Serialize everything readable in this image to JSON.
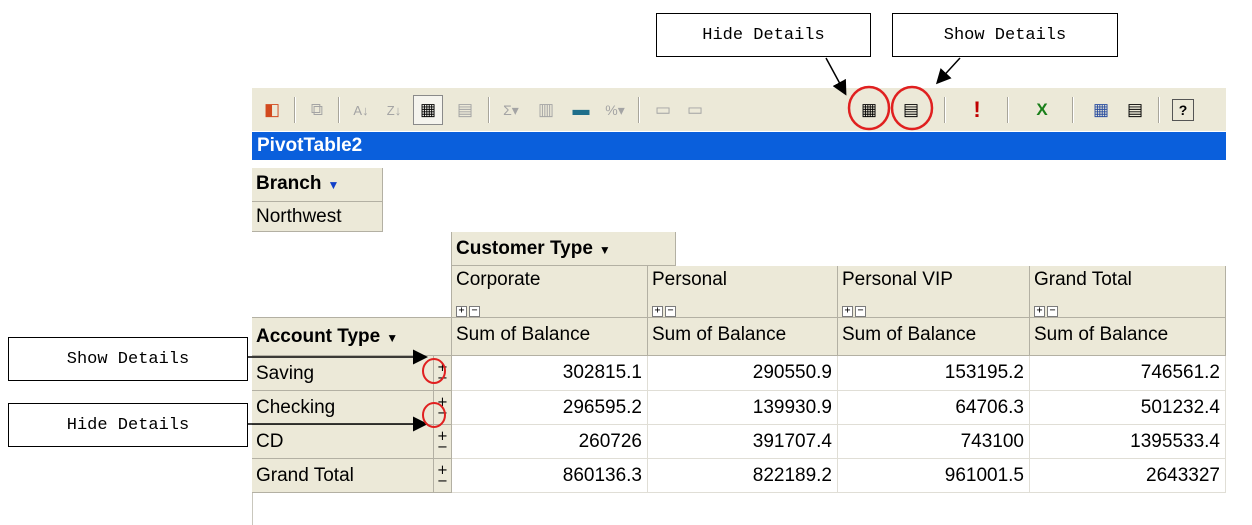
{
  "callouts": {
    "hide_details_top": "Hide Details",
    "show_details_top": "Show Details",
    "show_details_left": "Show Details",
    "hide_details_left": "Hide Details"
  },
  "toolbar": {
    "icons": [
      "office-logo-icon",
      "copy-icon",
      "sort-ascending-icon",
      "sort-descending-icon",
      "autofilter-icon",
      "show-top-bottom-icon",
      "autocalc-icon",
      "subtotal-icon",
      "calculated-totals-icon",
      "show-as-icon",
      "collapse-icon",
      "expand-icon",
      "hide-details-icon",
      "show-details-icon",
      "refresh-icon",
      "export-excel-icon",
      "field-list-icon",
      "property-toolbox-icon",
      "help-icon"
    ],
    "glyphs": {
      "office": "◧",
      "copy": "⧉",
      "sort_asc": "A↓",
      "sort_desc": "Z↓",
      "autofilter": "▦",
      "topbottom": "▤",
      "autocalc": "Σ▾",
      "subtotal": "▥",
      "calc": "▬",
      "showas": "%▾",
      "collapse": "▭",
      "expand": "▭",
      "hide": "▦",
      "show": "▤",
      "refresh": "!",
      "excel": "X",
      "fieldlist": "▦",
      "toolbox": "▤",
      "help": "?"
    }
  },
  "pivot": {
    "title": "PivotTable2",
    "filter_field": "Branch",
    "filter_value": "Northwest",
    "column_field": "Customer Type",
    "row_field": "Account Type",
    "columns": [
      "Corporate",
      "Personal",
      "Personal VIP",
      "Grand Total"
    ],
    "measure_label": "Sum of Balance",
    "plus": "+",
    "minus": "−",
    "rows": [
      {
        "label": "Saving",
        "values": [
          "302815.1",
          "290550.9",
          "153195.2",
          "746561.2"
        ]
      },
      {
        "label": "Checking",
        "values": [
          "296595.2",
          "139930.9",
          "64706.3",
          "501232.4"
        ]
      },
      {
        "label": "CD",
        "values": [
          "260726",
          "391707.4",
          "743100",
          "1395533.4"
        ]
      },
      {
        "label": "Grand Total",
        "values": [
          "860136.3",
          "822189.2",
          "961001.5",
          "2643327"
        ]
      }
    ]
  },
  "colors": {
    "title_bar": "#0a5fdc",
    "toolbar": "#ece9d8",
    "header_cell": "#ece9d8",
    "annotation_circle": "#e02020"
  }
}
